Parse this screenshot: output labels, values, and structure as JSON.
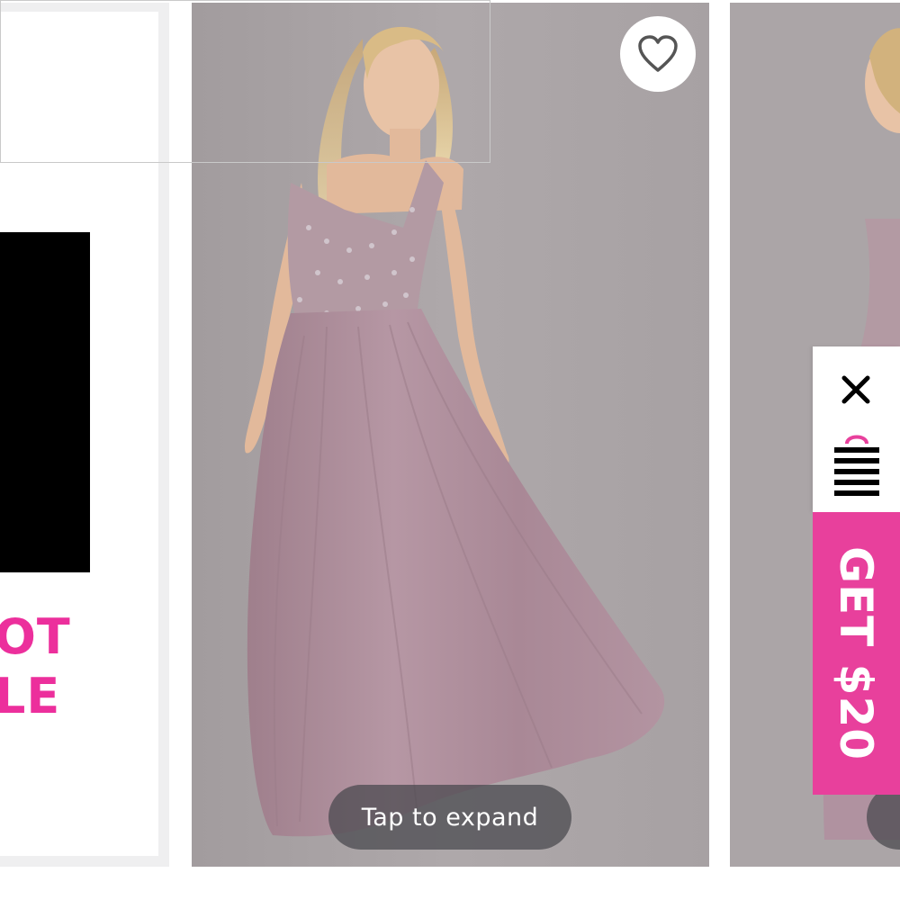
{
  "promo": {
    "text_line1": "OT",
    "text_line2": "LE",
    "accent_color": "#ec2f9c"
  },
  "product": {
    "expand_label": "Tap to expand",
    "favorite_icon": "heart-outline-icon",
    "dress_color": "#b08f9c",
    "background_color": "#a9a3a5"
  },
  "widget": {
    "close_icon": "close-icon",
    "bag_icon": "shopping-bag-icon",
    "cta_label": "GET $20",
    "cta_color": "#e8409c"
  }
}
